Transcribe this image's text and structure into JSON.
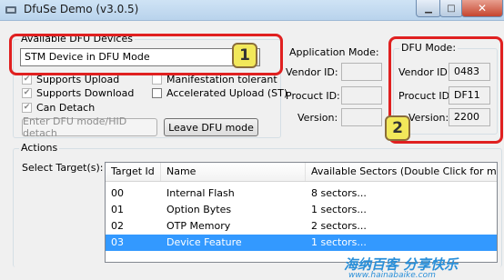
{
  "window": {
    "title": "DfuSe Demo (v3.0.5)"
  },
  "dfu_devices": {
    "legend": "Available DFU Devices",
    "selected_device": "STM Device in DFU Mode",
    "options": [
      {
        "label": "Supports Upload",
        "checked": true
      },
      {
        "label": "Supports Download",
        "checked": true
      },
      {
        "label": "Can Detach",
        "checked": true
      },
      {
        "label": "Manifestation tolerant",
        "checked": false
      },
      {
        "label": "Accelerated Upload (ST)",
        "checked": false
      }
    ],
    "enter_dfu_button": "Enter DFU mode/HID detach",
    "leave_dfu_button": "Leave DFU mode"
  },
  "application_mode": {
    "legend": "Application Mode:",
    "vendor_id_label": "Vendor ID:",
    "product_id_label": "Procuct ID:",
    "version_label": "Version:",
    "vendor_id": "",
    "product_id": "",
    "version": ""
  },
  "dfu_mode": {
    "legend": "DFU Mode:",
    "vendor_id_label": "Vendor ID:",
    "product_id_label": "Procuct ID:",
    "version_label": "Version:",
    "vendor_id": "0483",
    "product_id": "DF11",
    "version": "2200"
  },
  "annotations": {
    "badge1": "1",
    "badge2": "2",
    "color": "#e02020"
  },
  "actions": {
    "legend": "Actions",
    "select_targets_label": "Select Target(s):",
    "columns": [
      "Target Id",
      "Name",
      "Available Sectors (Double Click for more)"
    ],
    "rows": [
      {
        "id": "00",
        "name": "Internal Flash",
        "sectors": "8 sectors..."
      },
      {
        "id": "01",
        "name": "Option Bytes",
        "sectors": "1 sectors..."
      },
      {
        "id": "02",
        "name": "OTP Memory",
        "sectors": "2 sectors..."
      },
      {
        "id": "03",
        "name": "Device Feature",
        "sectors": "1 sectors..."
      }
    ],
    "selected_row_index": 3
  },
  "watermark": {
    "text": "海纳百客 分享快乐",
    "url": "www.hainabaike.com"
  }
}
